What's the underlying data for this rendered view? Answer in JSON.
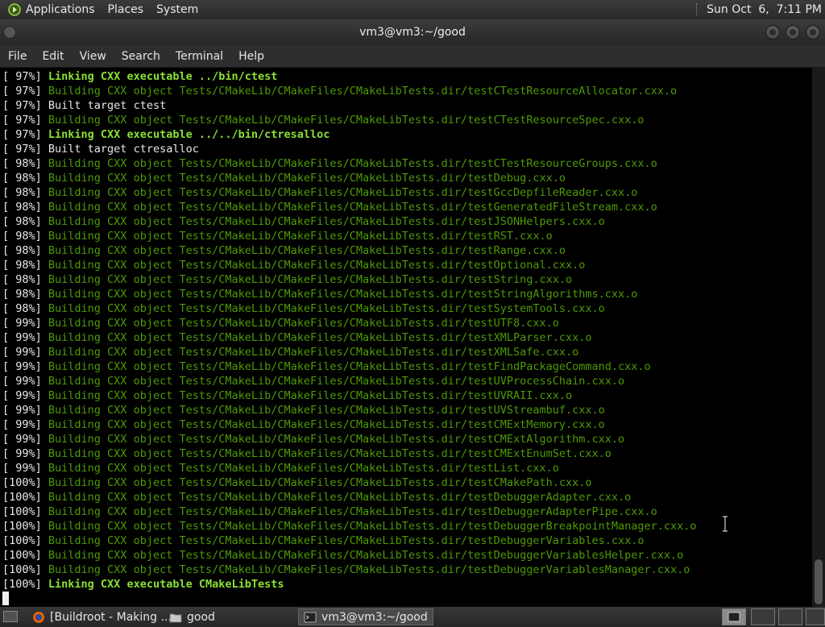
{
  "top_panel": {
    "menus": [
      "Applications",
      "Places",
      "System"
    ],
    "clock": "Sun Oct  6,  7:11 PM"
  },
  "window": {
    "title": "vm3@vm3:~/good"
  },
  "menubar": {
    "items": [
      "File",
      "Edit",
      "View",
      "Search",
      "Terminal",
      "Help"
    ]
  },
  "terminal": {
    "lines": [
      {
        "pct": "[ 97%] ",
        "text": "Linking CXX executable ../bin/ctest",
        "style": "b"
      },
      {
        "pct": "[ 97%] ",
        "text": "Building CXX object Tests/CMakeLib/CMakeFiles/CMakeLibTests.dir/testCTestResourceAllocator.cxx.o",
        "style": "g"
      },
      {
        "pct": "[ 97%] ",
        "text": "Built target ctest",
        "style": "w"
      },
      {
        "pct": "[ 97%] ",
        "text": "Building CXX object Tests/CMakeLib/CMakeFiles/CMakeLibTests.dir/testCTestResourceSpec.cxx.o",
        "style": "g"
      },
      {
        "pct": "[ 97%] ",
        "text": "Linking CXX executable ../../bin/ctresalloc",
        "style": "b"
      },
      {
        "pct": "[ 97%] ",
        "text": "Built target ctresalloc",
        "style": "w"
      },
      {
        "pct": "[ 98%] ",
        "text": "Building CXX object Tests/CMakeLib/CMakeFiles/CMakeLibTests.dir/testCTestResourceGroups.cxx.o",
        "style": "g"
      },
      {
        "pct": "[ 98%] ",
        "text": "Building CXX object Tests/CMakeLib/CMakeFiles/CMakeLibTests.dir/testDebug.cxx.o",
        "style": "g"
      },
      {
        "pct": "[ 98%] ",
        "text": "Building CXX object Tests/CMakeLib/CMakeFiles/CMakeLibTests.dir/testGccDepfileReader.cxx.o",
        "style": "g"
      },
      {
        "pct": "[ 98%] ",
        "text": "Building CXX object Tests/CMakeLib/CMakeFiles/CMakeLibTests.dir/testGeneratedFileStream.cxx.o",
        "style": "g"
      },
      {
        "pct": "[ 98%] ",
        "text": "Building CXX object Tests/CMakeLib/CMakeFiles/CMakeLibTests.dir/testJSONHelpers.cxx.o",
        "style": "g"
      },
      {
        "pct": "[ 98%] ",
        "text": "Building CXX object Tests/CMakeLib/CMakeFiles/CMakeLibTests.dir/testRST.cxx.o",
        "style": "g"
      },
      {
        "pct": "[ 98%] ",
        "text": "Building CXX object Tests/CMakeLib/CMakeFiles/CMakeLibTests.dir/testRange.cxx.o",
        "style": "g"
      },
      {
        "pct": "[ 98%] ",
        "text": "Building CXX object Tests/CMakeLib/CMakeFiles/CMakeLibTests.dir/testOptional.cxx.o",
        "style": "g"
      },
      {
        "pct": "[ 98%] ",
        "text": "Building CXX object Tests/CMakeLib/CMakeFiles/CMakeLibTests.dir/testString.cxx.o",
        "style": "g"
      },
      {
        "pct": "[ 98%] ",
        "text": "Building CXX object Tests/CMakeLib/CMakeFiles/CMakeLibTests.dir/testStringAlgorithms.cxx.o",
        "style": "g"
      },
      {
        "pct": "[ 98%] ",
        "text": "Building CXX object Tests/CMakeLib/CMakeFiles/CMakeLibTests.dir/testSystemTools.cxx.o",
        "style": "g"
      },
      {
        "pct": "[ 99%] ",
        "text": "Building CXX object Tests/CMakeLib/CMakeFiles/CMakeLibTests.dir/testUTF8.cxx.o",
        "style": "g"
      },
      {
        "pct": "[ 99%] ",
        "text": "Building CXX object Tests/CMakeLib/CMakeFiles/CMakeLibTests.dir/testXMLParser.cxx.o",
        "style": "g"
      },
      {
        "pct": "[ 99%] ",
        "text": "Building CXX object Tests/CMakeLib/CMakeFiles/CMakeLibTests.dir/testXMLSafe.cxx.o",
        "style": "g"
      },
      {
        "pct": "[ 99%] ",
        "text": "Building CXX object Tests/CMakeLib/CMakeFiles/CMakeLibTests.dir/testFindPackageCommand.cxx.o",
        "style": "g"
      },
      {
        "pct": "[ 99%] ",
        "text": "Building CXX object Tests/CMakeLib/CMakeFiles/CMakeLibTests.dir/testUVProcessChain.cxx.o",
        "style": "g"
      },
      {
        "pct": "[ 99%] ",
        "text": "Building CXX object Tests/CMakeLib/CMakeFiles/CMakeLibTests.dir/testUVRAII.cxx.o",
        "style": "g"
      },
      {
        "pct": "[ 99%] ",
        "text": "Building CXX object Tests/CMakeLib/CMakeFiles/CMakeLibTests.dir/testUVStreambuf.cxx.o",
        "style": "g"
      },
      {
        "pct": "[ 99%] ",
        "text": "Building CXX object Tests/CMakeLib/CMakeFiles/CMakeLibTests.dir/testCMExtMemory.cxx.o",
        "style": "g"
      },
      {
        "pct": "[ 99%] ",
        "text": "Building CXX object Tests/CMakeLib/CMakeFiles/CMakeLibTests.dir/testCMExtAlgorithm.cxx.o",
        "style": "g"
      },
      {
        "pct": "[ 99%] ",
        "text": "Building CXX object Tests/CMakeLib/CMakeFiles/CMakeLibTests.dir/testCMExtEnumSet.cxx.o",
        "style": "g"
      },
      {
        "pct": "[ 99%] ",
        "text": "Building CXX object Tests/CMakeLib/CMakeFiles/CMakeLibTests.dir/testList.cxx.o",
        "style": "g"
      },
      {
        "pct": "[100%] ",
        "text": "Building CXX object Tests/CMakeLib/CMakeFiles/CMakeLibTests.dir/testCMakePath.cxx.o",
        "style": "g"
      },
      {
        "pct": "[100%] ",
        "text": "Building CXX object Tests/CMakeLib/CMakeFiles/CMakeLibTests.dir/testDebuggerAdapter.cxx.o",
        "style": "g"
      },
      {
        "pct": "[100%] ",
        "text": "Building CXX object Tests/CMakeLib/CMakeFiles/CMakeLibTests.dir/testDebuggerAdapterPipe.cxx.o",
        "style": "g"
      },
      {
        "pct": "[100%] ",
        "text": "Building CXX object Tests/CMakeLib/CMakeFiles/CMakeLibTests.dir/testDebuggerBreakpointManager.cxx.o",
        "style": "g"
      },
      {
        "pct": "[100%] ",
        "text": "Building CXX object Tests/CMakeLib/CMakeFiles/CMakeLibTests.dir/testDebuggerVariables.cxx.o",
        "style": "g"
      },
      {
        "pct": "[100%] ",
        "text": "Building CXX object Tests/CMakeLib/CMakeFiles/CMakeLibTests.dir/testDebuggerVariablesHelper.cxx.o",
        "style": "g"
      },
      {
        "pct": "[100%] ",
        "text": "Building CXX object Tests/CMakeLib/CMakeFiles/CMakeLibTests.dir/testDebuggerVariablesManager.cxx.o",
        "style": "g"
      },
      {
        "pct": "[100%] ",
        "text": "Linking CXX executable CMakeLibTests",
        "style": "b"
      }
    ]
  },
  "taskbar": {
    "tasks": [
      {
        "label": "[Buildroot - Making ...",
        "icon": "firefox-icon",
        "active": false
      },
      {
        "label": "good",
        "icon": "folder-icon",
        "active": false
      },
      {
        "label": "vm3@vm3:~/good",
        "icon": "terminal-icon",
        "active": true
      }
    ]
  },
  "colors": {
    "build_green": "#4e9a06",
    "link_green": "#8ae234",
    "background": "#000000"
  }
}
